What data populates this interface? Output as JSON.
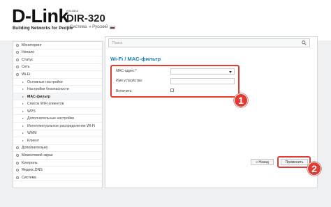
{
  "header": {
    "logo": "D-Link",
    "tagline": "Building Networks for People",
    "emulator": "emulator",
    "model": "DIR-320",
    "system_link": "« Система",
    "language": "« Русский"
  },
  "sidebar": {
    "items": [
      {
        "label": "Мониторинг",
        "level": "top"
      },
      {
        "label": "Начало",
        "level": "top"
      },
      {
        "label": "Статус",
        "level": "top"
      },
      {
        "label": "Сеть",
        "level": "top"
      },
      {
        "label": "Wi-Fi",
        "level": "top"
      },
      {
        "label": "Основные настройки",
        "level": "sub"
      },
      {
        "label": "Настройки безопасности",
        "level": "sub"
      },
      {
        "label": "MAC-фильтр",
        "level": "sub",
        "active": true
      },
      {
        "label": "Список WiFi клиентов",
        "level": "sub"
      },
      {
        "label": "WPS",
        "level": "sub"
      },
      {
        "label": "Дополнительные настройки",
        "level": "sub"
      },
      {
        "label": "Интеллектуальное распределение Wi-Fi",
        "level": "sub"
      },
      {
        "label": "WMM",
        "level": "sub"
      },
      {
        "label": "Клиент",
        "level": "sub"
      },
      {
        "label": "Дополнительно",
        "level": "top"
      },
      {
        "label": "Межсетевой экран",
        "level": "top"
      },
      {
        "label": "Контроль",
        "level": "top"
      },
      {
        "label": "Яндекс.DNS",
        "level": "top"
      },
      {
        "label": "Система",
        "level": "top"
      }
    ]
  },
  "search": {
    "placeholder": "Поиск"
  },
  "page": {
    "title": "Wi-Fi /  MAC-фильтр"
  },
  "form": {
    "mac_label": "MAC-адрес:*",
    "mac_value": "",
    "name_label": "Имя устройства:",
    "name_value": "",
    "enable_label": "Включить:",
    "enable_checked": false
  },
  "buttons": {
    "back": "« Назад",
    "apply": "Применить"
  },
  "annotations": {
    "step1": "1",
    "step2": "2"
  },
  "colors": {
    "accent": "#1a7fb5",
    "highlight": "#e23b32"
  }
}
